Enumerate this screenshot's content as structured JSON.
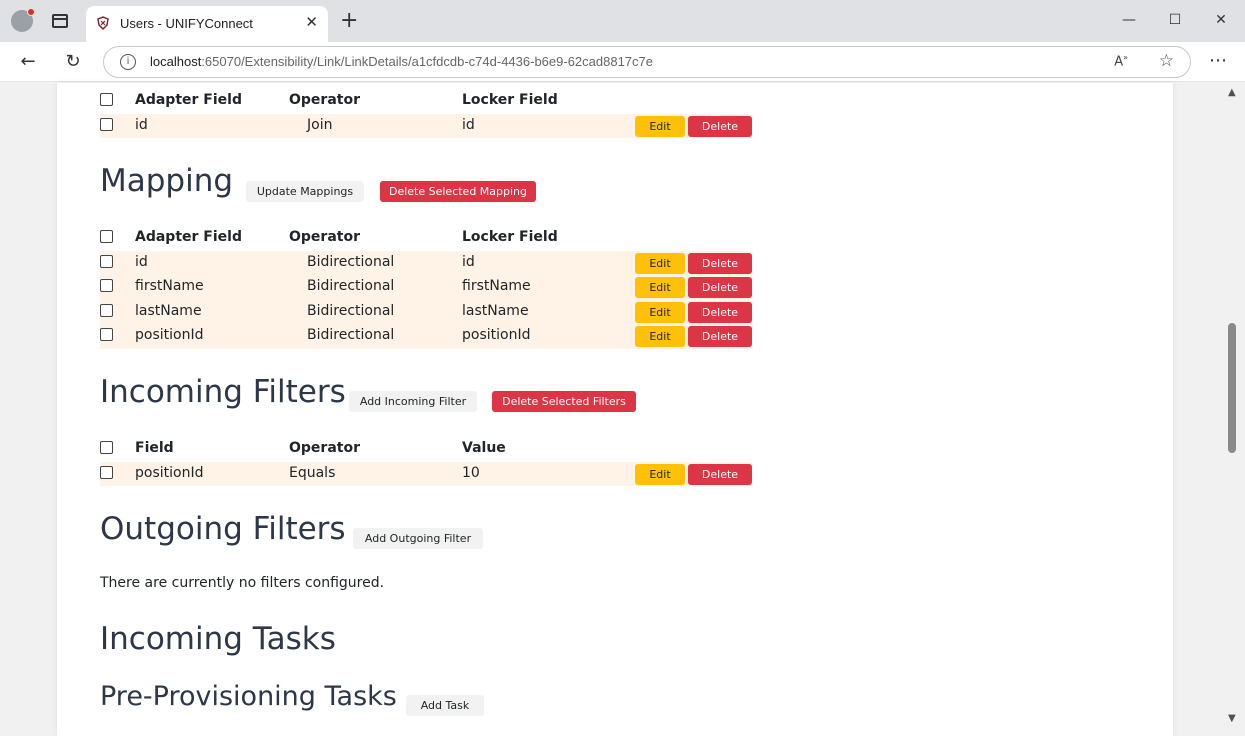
{
  "browser": {
    "tab_title": "Users - UNIFYConnect",
    "url_host": "localhost",
    "url_path": ":65070/Extensibility/Link/LinkDetails/a1cfdcdb-c74d-4436-b6e9-62cad8817c7e"
  },
  "join": {
    "headers": [
      "Adapter Field",
      "Operator",
      "Locker Field"
    ],
    "rows": [
      {
        "adapter": "id",
        "operator": "Join",
        "locker": "id",
        "edit": "Edit",
        "delete": "Delete"
      }
    ]
  },
  "mapping": {
    "title": "Mapping",
    "update_btn": "Update Mappings",
    "delete_selected_btn": "Delete Selected Mapping",
    "headers": [
      "Adapter Field",
      "Operator",
      "Locker Field"
    ],
    "rows": [
      {
        "adapter": "id",
        "operator": "Bidirectional",
        "locker": "id",
        "edit": "Edit",
        "delete": "Delete"
      },
      {
        "adapter": "firstName",
        "operator": "Bidirectional",
        "locker": "firstName",
        "edit": "Edit",
        "delete": "Delete"
      },
      {
        "adapter": "lastName",
        "operator": "Bidirectional",
        "locker": "lastName",
        "edit": "Edit",
        "delete": "Delete"
      },
      {
        "adapter": "positionId",
        "operator": "Bidirectional",
        "locker": "positionId",
        "edit": "Edit",
        "delete": "Delete"
      }
    ]
  },
  "incoming_filters": {
    "title": "Incoming Filters",
    "add_btn": "Add Incoming Filter",
    "delete_selected_btn": "Delete Selected Filters",
    "headers": [
      "Field",
      "Operator",
      "Value"
    ],
    "rows": [
      {
        "field": "positionId",
        "operator": "Equals",
        "value": "10",
        "edit": "Edit",
        "delete": "Delete"
      }
    ]
  },
  "outgoing_filters": {
    "title": "Outgoing Filters",
    "add_btn": "Add Outgoing Filter",
    "empty_text": "There are currently no filters configured."
  },
  "incoming_tasks": {
    "title": "Incoming Tasks"
  },
  "pre_provisioning_tasks": {
    "title": "Pre-Provisioning Tasks",
    "add_btn": "Add Task"
  }
}
